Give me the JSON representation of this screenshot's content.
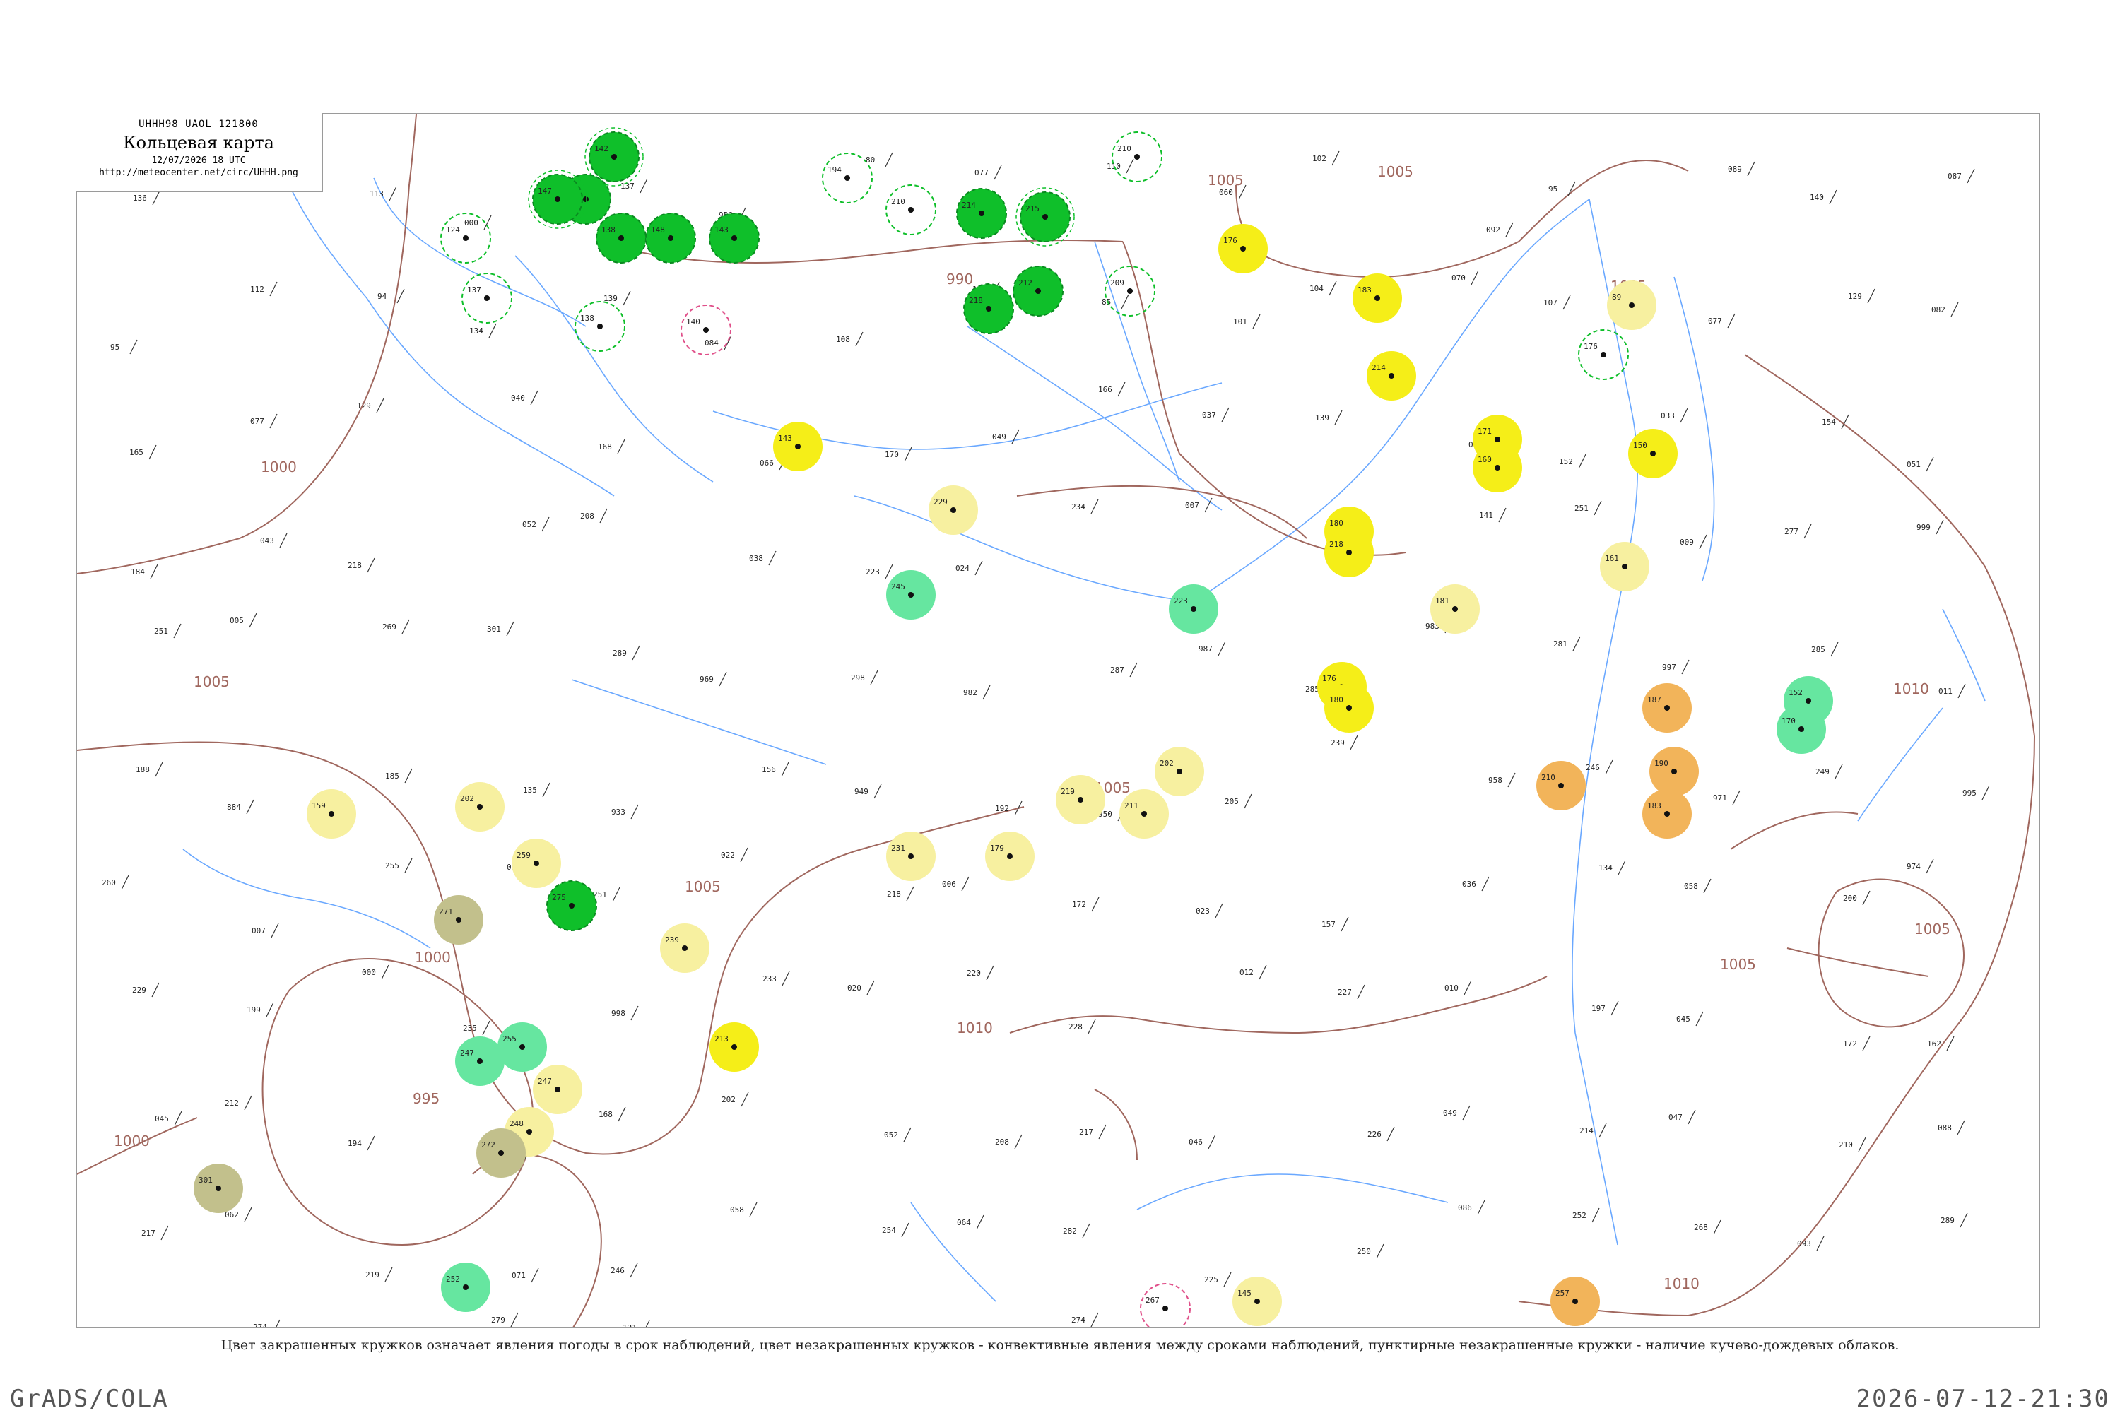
{
  "header": {
    "code": "UHHH98 UAOL 121800",
    "title": "Кольцевая карта",
    "date": "12/07/2026 18 UTC",
    "url": "http://meteocenter.net/circ/UHHH.png"
  },
  "caption": "Цвет закрашенных кружков означает явления погоды в срок наблюдений, цвет незакрашенных кружков - конвективные явления между сроками наблюдений, пунктирные незакрашенные кружки - наличие кучево-дождевых облаков.",
  "footer": {
    "left": "GrADS/COLA",
    "right": "2026-07-12-21:30"
  },
  "colors": {
    "rain_green": "#0fbf2a",
    "drizzle_yellow": "#f5ee18",
    "light_yellow": "#f7f0a0",
    "mint": "#66e6a0",
    "fog_olive": "#c2c08c",
    "haze_orange": "#f2b45a",
    "isobar": "#a0675e",
    "river": "#6aa8ff",
    "frame": "#9a9a9a"
  },
  "isobar_labels": [
    {
      "text": "1000"
    },
    {
      "text": "1005"
    },
    {
      "text": "990"
    },
    {
      "text": "1005"
    },
    {
      "text": "1005"
    },
    {
      "text": "1005"
    },
    {
      "text": "1005"
    },
    {
      "text": "1010"
    },
    {
      "text": "1000"
    },
    {
      "text": "995"
    },
    {
      "text": "1000"
    },
    {
      "text": "1010"
    },
    {
      "text": "1005"
    },
    {
      "text": "1005"
    },
    {
      "text": "1010"
    },
    {
      "text": "1005"
    }
  ],
  "stations": [
    {
      "label": "142",
      "style": "green"
    },
    {
      "label": "146",
      "style": "green"
    },
    {
      "label": "138",
      "style": "green"
    },
    {
      "label": "147",
      "style": "green"
    },
    {
      "label": "148",
      "style": "green"
    },
    {
      "label": "143",
      "style": "green"
    },
    {
      "label": "194",
      "style": "ring"
    },
    {
      "label": "210",
      "style": "ring"
    },
    {
      "label": "214",
      "style": "green"
    },
    {
      "label": "215",
      "style": "green"
    },
    {
      "label": "210",
      "style": "ring"
    },
    {
      "label": "124",
      "style": "ring"
    },
    {
      "label": "137",
      "style": "ring"
    },
    {
      "label": "138",
      "style": "ring"
    },
    {
      "label": "140",
      "style": "ringpink"
    },
    {
      "label": "143",
      "style": "yellow"
    },
    {
      "label": "218",
      "style": "green"
    },
    {
      "label": "212",
      "style": "green"
    },
    {
      "label": "229",
      "style": "lightyellow"
    },
    {
      "label": "245",
      "style": "mint"
    },
    {
      "label": "209",
      "style": "ring"
    },
    {
      "label": "176",
      "style": "yellow"
    },
    {
      "label": "183",
      "style": "yellow"
    },
    {
      "label": "214",
      "style": "yellow"
    },
    {
      "label": "180",
      "style": "yellow"
    },
    {
      "label": "171",
      "style": "yellow"
    },
    {
      "label": "160",
      "style": "yellow"
    },
    {
      "label": "89",
      "style": "lightyellow"
    },
    {
      "label": "150",
      "style": "yellow"
    },
    {
      "label": "176",
      "style": "ring"
    },
    {
      "label": "218",
      "style": "yellow"
    },
    {
      "label": "223",
      "style": "mint"
    },
    {
      "label": "176",
      "style": "yellow"
    },
    {
      "label": "180",
      "style": "yellow"
    },
    {
      "label": "181",
      "style": "lightyellow"
    },
    {
      "label": "161",
      "style": "lightyellow"
    },
    {
      "label": "187",
      "style": "orange"
    },
    {
      "label": "190",
      "style": "orange"
    },
    {
      "label": "183",
      "style": "orange"
    },
    {
      "label": "210",
      "style": "orange"
    },
    {
      "label": "152",
      "style": "mint"
    },
    {
      "label": "170",
      "style": "mint"
    },
    {
      "label": "159",
      "style": "lightyellow"
    },
    {
      "label": "202",
      "style": "lightyellow"
    },
    {
      "label": "259",
      "style": "lightyellow"
    },
    {
      "label": "271",
      "style": "olive"
    },
    {
      "label": "275",
      "style": "green"
    },
    {
      "label": "239",
      "style": "lightyellow"
    },
    {
      "label": "213",
      "style": "yellow"
    },
    {
      "label": "231",
      "style": "lightyellow"
    },
    {
      "label": "179",
      "style": "lightyellow"
    },
    {
      "label": "219",
      "style": "lightyellow"
    },
    {
      "label": "211",
      "style": "lightyellow"
    },
    {
      "label": "202",
      "style": "lightyellow"
    },
    {
      "label": "247",
      "style": "mint"
    },
    {
      "label": "255",
      "style": "mint"
    },
    {
      "label": "247",
      "style": "lightyellow"
    },
    {
      "label": "248",
      "style": "lightyellow"
    },
    {
      "label": "272",
      "style": "olive"
    },
    {
      "label": "301",
      "style": "olive"
    },
    {
      "label": "252",
      "style": "mint"
    },
    {
      "label": "257",
      "style": "orange"
    },
    {
      "label": "145",
      "style": "lightyellow"
    },
    {
      "label": "267",
      "style": "ringpink"
    }
  ],
  "small_numbers": [
    "136",
    "030",
    "113",
    "000",
    "137",
    "956",
    "80",
    "077",
    "110",
    "060",
    "102",
    "092",
    "95",
    "089",
    "140",
    "087",
    "95",
    "112",
    "94",
    "134",
    "139",
    "084",
    "108",
    "109",
    "85",
    "101",
    "104",
    "070",
    "107",
    "077",
    "129",
    "082",
    "165",
    "077",
    "129",
    "040",
    "168",
    "066",
    "170",
    "049",
    "166",
    "037",
    "139",
    "057",
    "152",
    "033",
    "154",
    "051",
    "184",
    "043",
    "218",
    "052",
    "208",
    "038",
    "223",
    "024",
    "234",
    "007",
    "296",
    "141",
    "251",
    "009",
    "277",
    "999",
    "251",
    "005",
    "269",
    "301",
    "289",
    "969",
    "298",
    "982",
    "287",
    "987",
    "285",
    "983",
    "281",
    "997",
    "285",
    "011",
    "188",
    "884",
    "185",
    "135",
    "933",
    "156",
    "949",
    "192",
    "950",
    "205",
    "239",
    "958",
    "246",
    "971",
    "249",
    "995",
    "260",
    "007",
    "255",
    "032",
    "251",
    "022",
    "218",
    "006",
    "172",
    "023",
    "157",
    "036",
    "134",
    "058",
    "200",
    "974",
    "229",
    "199",
    "000",
    "235",
    "998",
    "233",
    "020",
    "220",
    "228",
    "012",
    "227",
    "010",
    "197",
    "045",
    "172",
    "162",
    "045",
    "212",
    "194",
    "189",
    "168",
    "202",
    "052",
    "208",
    "217",
    "046",
    "226",
    "049",
    "214",
    "047",
    "210",
    "088",
    "217",
    "062",
    "219",
    "071",
    "246",
    "058",
    "254",
    "064",
    "282",
    "225",
    "250",
    "086",
    "252",
    "268",
    "093",
    "289",
    "104",
    "274",
    "117",
    "279",
    "121",
    "265",
    "262",
    "126",
    "274",
    "109"
  ]
}
